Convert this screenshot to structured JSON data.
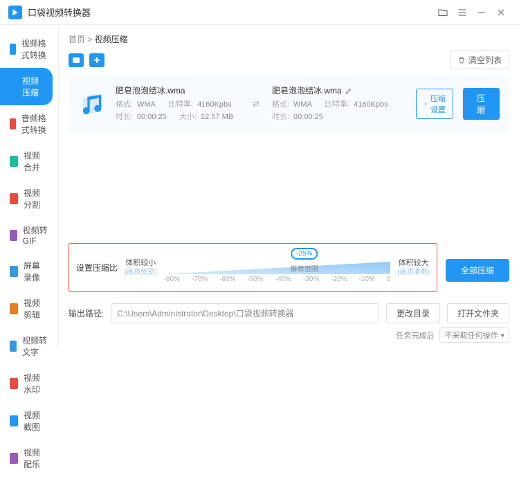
{
  "app": {
    "title": "口袋视频转换器"
  },
  "sidebar": {
    "items": [
      {
        "label": "视频格式转换",
        "c": "#2196f3"
      },
      {
        "label": "视频压缩",
        "c": "#2196f3"
      },
      {
        "label": "音频格式转换",
        "c": "#e74c3c"
      },
      {
        "label": "视频合并",
        "c": "#1abc9c"
      },
      {
        "label": "视频分割",
        "c": "#e74c3c"
      },
      {
        "label": "视频转GIF",
        "c": "#9b59b6"
      },
      {
        "label": "屏幕录像",
        "c": "#3498db"
      },
      {
        "label": "视频剪辑",
        "c": "#e67e22"
      },
      {
        "label": "视频转文字",
        "c": "#3498db"
      },
      {
        "label": "视频水印",
        "c": "#e74c3c"
      },
      {
        "label": "视频截图",
        "c": "#2196f3"
      },
      {
        "label": "视频配乐",
        "c": "#9b59b6"
      }
    ]
  },
  "breadcrumb": {
    "home": "首页",
    "current": "视频压缩",
    "sep": " > "
  },
  "toolbar": {
    "clear": "清空列表"
  },
  "file": {
    "name": "肥皂泡泡结冰.wma",
    "fmt_l": "格式:",
    "fmt": "WMA",
    "br_l": "比特率:",
    "br": "4160Kpbs",
    "dur_l": "时长:",
    "dur": "00:00:25",
    "size_l": "大小:",
    "size": "12.57 MB"
  },
  "out": {
    "name": "肥皂泡泡结冰.wma",
    "fmt_l": "格式:",
    "fmt": "WMA",
    "br_l": "比特率:",
    "br": "4160Kpbs",
    "dur_l": "时长:",
    "dur": "00:00:25"
  },
  "actions": {
    "settings": "压缩设置",
    "compress": "压缩",
    "compress_all": "全部压缩"
  },
  "ratio": {
    "label": "设置压缩比",
    "small": "体积较小",
    "small_sub": "(画质受损)",
    "large": "体积较大",
    "large_sub": "(画质清晰)",
    "badge": "-25%",
    "tick_label": "推荐范围",
    "ticks": [
      "-80%",
      "-70%",
      "-60%",
      "-50%",
      "-40%",
      "-30%",
      "-20%",
      "-10%",
      "0"
    ]
  },
  "path": {
    "label": "输出路径:",
    "value": "C:\\Users\\Administrator\\Desktop\\口袋视频转换器",
    "change": "更改目录",
    "open": "打开文件夹"
  },
  "footer": {
    "after": "任务完成后",
    "opt": "不采取任何操作"
  }
}
